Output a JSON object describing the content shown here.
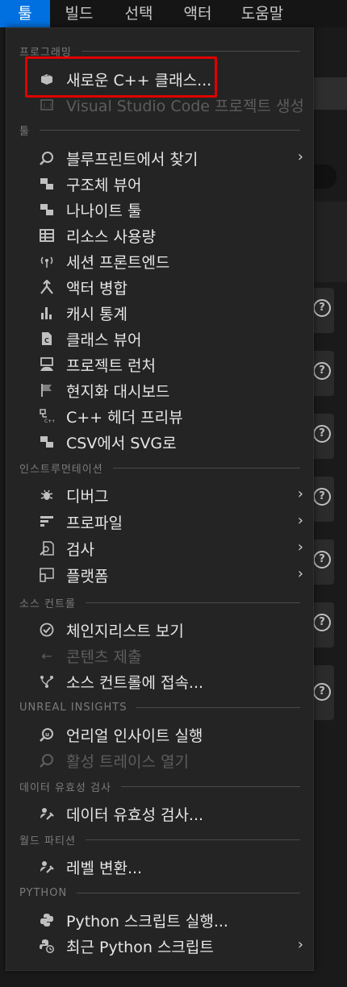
{
  "menubar": {
    "items": [
      {
        "label": "툴",
        "active": true
      },
      {
        "label": "빌드",
        "active": false
      },
      {
        "label": "선택",
        "active": false
      },
      {
        "label": "액터",
        "active": false
      },
      {
        "label": "도움말",
        "active": false
      }
    ]
  },
  "menu": {
    "sections": {
      "programming": "프로그래밍",
      "tools": "툴",
      "instrumentation": "인스트루먼테이션",
      "source_control": "소스 컨트롤",
      "unreal_insights": "UNREAL INSIGHTS",
      "data_validation": "데이터 유효성 검사",
      "world_partition": "월드 파티션",
      "python": "PYTHON"
    },
    "items": {
      "new_cpp_class": "새로운 C++ 클래스...",
      "vscode_project": "Visual Studio Code 프로젝트 생성",
      "find_in_blueprints": "블루프린트에서 찾기",
      "struct_viewer": "구조체 뷰어",
      "niagara_tool": "나나이트 툴",
      "resource_usage": "리소스 사용량",
      "session_frontend": "세션 프론트엔드",
      "merge_actors": "액터 병합",
      "cache_stats": "캐시 통계",
      "class_viewer": "클래스 뷰어",
      "project_launcher": "프로젝트 런처",
      "localization_dashboard": "현지화 대시보드",
      "cpp_header_preview": "C++ 헤더 프리뷰",
      "csv_to_svg": "CSV에서 SVG로",
      "debug": "디버그",
      "profile": "프로파일",
      "audit": "검사",
      "platforms": "플랫폼",
      "view_changelists": "체인지리스트 보기",
      "submit_content": "콘텐츠 제출",
      "connect_source_control": "소스 컨트롤에 접속...",
      "run_unreal_insights": "언리얼 인사이트 실행",
      "open_live_trace": "활성 트레이스 열기",
      "validate_data": "데이터 유효성 검사...",
      "convert_level": "레벨 변환...",
      "run_python_script": "Python 스크립트 실행...",
      "recent_python_scripts": "최근 Python 스크립트"
    }
  },
  "colors": {
    "accent": "#0070e0",
    "highlight_border": "#e00000"
  }
}
